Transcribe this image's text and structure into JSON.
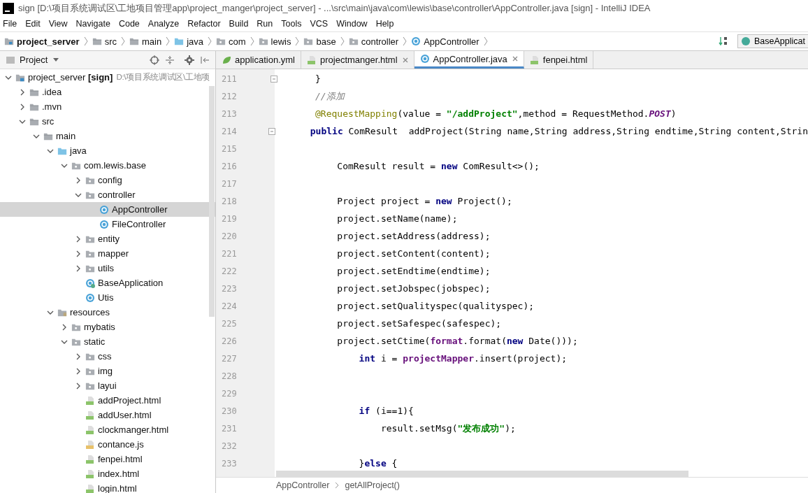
{
  "window": {
    "title": "sign [D:\\项目系统调试区\\工地项目管理app\\project_manger\\project_server] - ...\\src\\main\\java\\com\\lewis\\base\\controller\\AppController.java [sign] - IntelliJ IDEA"
  },
  "menu": [
    "File",
    "Edit",
    "View",
    "Navigate",
    "Code",
    "Analyze",
    "Refactor",
    "Build",
    "Run",
    "Tools",
    "VCS",
    "Window",
    "Help"
  ],
  "navbar": {
    "crumbs": [
      {
        "label": "project_server",
        "kind": "module"
      },
      {
        "label": "src",
        "kind": "folder"
      },
      {
        "label": "main",
        "kind": "folder"
      },
      {
        "label": "java",
        "kind": "source"
      },
      {
        "label": "com",
        "kind": "package"
      },
      {
        "label": "lewis",
        "kind": "package"
      },
      {
        "label": "base",
        "kind": "package"
      },
      {
        "label": "controller",
        "kind": "package"
      },
      {
        "label": "AppController",
        "kind": "class"
      }
    ],
    "run_config": "BaseApplicat"
  },
  "project_panel": {
    "title": "Project",
    "tree": [
      {
        "label": "project_server **[sign]**",
        "path": "D:\\项目系统调试区\\工地项",
        "kind": "module",
        "expanded": true,
        "selected": false,
        "children": [
          {
            "label": ".idea",
            "kind": "folder",
            "expanded": false,
            "selected": false
          },
          {
            "label": ".mvn",
            "kind": "folder",
            "expanded": false,
            "selected": false
          },
          {
            "label": "src",
            "kind": "folder",
            "expanded": true,
            "selected": false,
            "children": [
              {
                "label": "main",
                "kind": "folder",
                "expanded": true,
                "selected": false,
                "children": [
                  {
                    "label": "java",
                    "kind": "source",
                    "expanded": true,
                    "selected": false,
                    "children": [
                      {
                        "label": "com.lewis.base",
                        "kind": "package",
                        "expanded": true,
                        "selected": false,
                        "children": [
                          {
                            "label": "config",
                            "kind": "package",
                            "expanded": false,
                            "selected": false
                          },
                          {
                            "label": "controller",
                            "kind": "package",
                            "expanded": true,
                            "selected": false,
                            "children": [
                              {
                                "label": "AppController",
                                "kind": "class",
                                "selected": true
                              },
                              {
                                "label": "FileController",
                                "kind": "class",
                                "selected": false
                              }
                            ]
                          },
                          {
                            "label": "entity",
                            "kind": "package",
                            "expanded": false,
                            "selected": false
                          },
                          {
                            "label": "mapper",
                            "kind": "package",
                            "expanded": false,
                            "selected": false
                          },
                          {
                            "label": "utils",
                            "kind": "package",
                            "expanded": false,
                            "selected": false
                          },
                          {
                            "label": "BaseApplication",
                            "kind": "app",
                            "selected": false
                          },
                          {
                            "label": "Utis",
                            "kind": "class",
                            "selected": false
                          }
                        ]
                      }
                    ]
                  },
                  {
                    "label": "resources",
                    "kind": "resources",
                    "expanded": true,
                    "selected": false,
                    "children": [
                      {
                        "label": "mybatis",
                        "kind": "package",
                        "expanded": false,
                        "selected": false
                      },
                      {
                        "label": "static",
                        "kind": "package",
                        "expanded": true,
                        "selected": false,
                        "children": [
                          {
                            "label": "css",
                            "kind": "package",
                            "expanded": false,
                            "selected": false
                          },
                          {
                            "label": "img",
                            "kind": "package",
                            "expanded": false,
                            "selected": false
                          },
                          {
                            "label": "layui",
                            "kind": "package",
                            "expanded": false,
                            "selected": false
                          },
                          {
                            "label": "addProject.html",
                            "kind": "html",
                            "selected": false
                          },
                          {
                            "label": "addUser.html",
                            "kind": "html",
                            "selected": false
                          },
                          {
                            "label": "clockmanger.html",
                            "kind": "html",
                            "selected": false
                          },
                          {
                            "label": "contance.js",
                            "kind": "js",
                            "selected": false
                          },
                          {
                            "label": "fenpei.html",
                            "kind": "html",
                            "selected": false
                          },
                          {
                            "label": "index.html",
                            "kind": "html",
                            "selected": false
                          },
                          {
                            "label": "login.html",
                            "kind": "html",
                            "selected": false
                          }
                        ]
                      }
                    ]
                  }
                ]
              }
            ]
          }
        ]
      }
    ]
  },
  "editor": {
    "tabs": [
      {
        "label": "application.yml",
        "kind": "yml",
        "selected": false,
        "close": false
      },
      {
        "label": "projectmanger.html",
        "kind": "html",
        "selected": false,
        "close": true
      },
      {
        "label": "AppController.java",
        "kind": "class",
        "selected": true,
        "close": true
      },
      {
        "label": "fenpei.html",
        "kind": "html",
        "selected": false,
        "close": false
      }
    ],
    "lines": [
      {
        "number": "211",
        "fold": true,
        "tokens": [
          {
            "kind": "plain",
            "text": "}"
          }
        ]
      },
      {
        "number": "212",
        "tokens": [
          {
            "kind": "comment",
            "text": "//添加"
          }
        ]
      },
      {
        "number": "213",
        "tokens": [
          {
            "kind": "annotation",
            "text": "@RequestMapping"
          },
          {
            "kind": "plain",
            "text": "(value = "
          },
          {
            "kind": "string",
            "text": "\"/addProject\""
          },
          {
            "kind": "plain",
            "text": ",method = RequestMethod."
          },
          {
            "kind": "constant",
            "text": "POST"
          },
          {
            "kind": "plain",
            "text": ")"
          }
        ]
      },
      {
        "number": "214",
        "fold": true,
        "tokens": [
          {
            "kind": "keyword",
            "text": "public"
          },
          {
            "kind": "plain",
            "text": " ComResult  addProject(String name,String address,String endtime,String content,Strin"
          }
        ]
      },
      {
        "number": "215"
      },
      {
        "number": "216",
        "tokens": [
          {
            "kind": "plain",
            "text": "    ComResult result = "
          },
          {
            "kind": "keyword",
            "text": "new"
          },
          {
            "kind": "plain",
            "text": " ComResult<>();"
          }
        ]
      },
      {
        "number": "217"
      },
      {
        "number": "218",
        "tokens": [
          {
            "kind": "plain",
            "text": "    Project project = "
          },
          {
            "kind": "keyword",
            "text": "new"
          },
          {
            "kind": "plain",
            "text": " Project();"
          }
        ]
      },
      {
        "number": "219",
        "tokens": [
          {
            "kind": "plain",
            "text": "    project.setName(name);"
          }
        ]
      },
      {
        "number": "220",
        "tokens": [
          {
            "kind": "plain",
            "text": "    project.setAddress(address);"
          }
        ]
      },
      {
        "number": "221",
        "tokens": [
          {
            "kind": "plain",
            "text": "    project.setContent(content);"
          }
        ]
      },
      {
        "number": "222",
        "tokens": [
          {
            "kind": "plain",
            "text": "    project.setEndtime(endtime);"
          }
        ]
      },
      {
        "number": "223",
        "tokens": [
          {
            "kind": "plain",
            "text": "    project.setJobspec(jobspec);"
          }
        ]
      },
      {
        "number": "224",
        "tokens": [
          {
            "kind": "plain",
            "text": "    project.setQualityspec(qualityspec);"
          }
        ]
      },
      {
        "number": "225",
        "tokens": [
          {
            "kind": "plain",
            "text": "    project.setSafespec(safespec);"
          }
        ]
      },
      {
        "number": "226",
        "tokens": [
          {
            "kind": "plain",
            "text": "    project.setCtime("
          },
          {
            "kind": "field",
            "text": "format"
          },
          {
            "kind": "plain",
            "text": ".format("
          },
          {
            "kind": "keyword",
            "text": "new"
          },
          {
            "kind": "plain",
            "text": " Date()));"
          }
        ]
      },
      {
        "number": "227",
        "tokens": [
          {
            "kind": "keyword",
            "text": "        int"
          },
          {
            "kind": "plain",
            "text": " i = "
          },
          {
            "kind": "field",
            "text": "projectMapper"
          },
          {
            "kind": "plain",
            "text": ".insert(project);"
          }
        ]
      },
      {
        "number": "228"
      },
      {
        "number": "229"
      },
      {
        "number": "230",
        "tokens": [
          {
            "kind": "keyword",
            "text": "        if"
          },
          {
            "kind": "plain",
            "text": " (i==1){"
          }
        ]
      },
      {
        "number": "231",
        "tokens": [
          {
            "kind": "plain",
            "text": "            result.setMsg("
          },
          {
            "kind": "string",
            "text": "\"发布成功\""
          },
          {
            "kind": "plain",
            "text": ");"
          }
        ]
      },
      {
        "number": "232"
      },
      {
        "number": "233",
        "tokens": [
          {
            "kind": "plain",
            "text": "        }"
          },
          {
            "kind": "keyword",
            "text": "else"
          },
          {
            "kind": "plain",
            "text": " {"
          }
        ]
      }
    ],
    "breadcrumbs": [
      "AppController",
      "getAllProject()"
    ]
  }
}
